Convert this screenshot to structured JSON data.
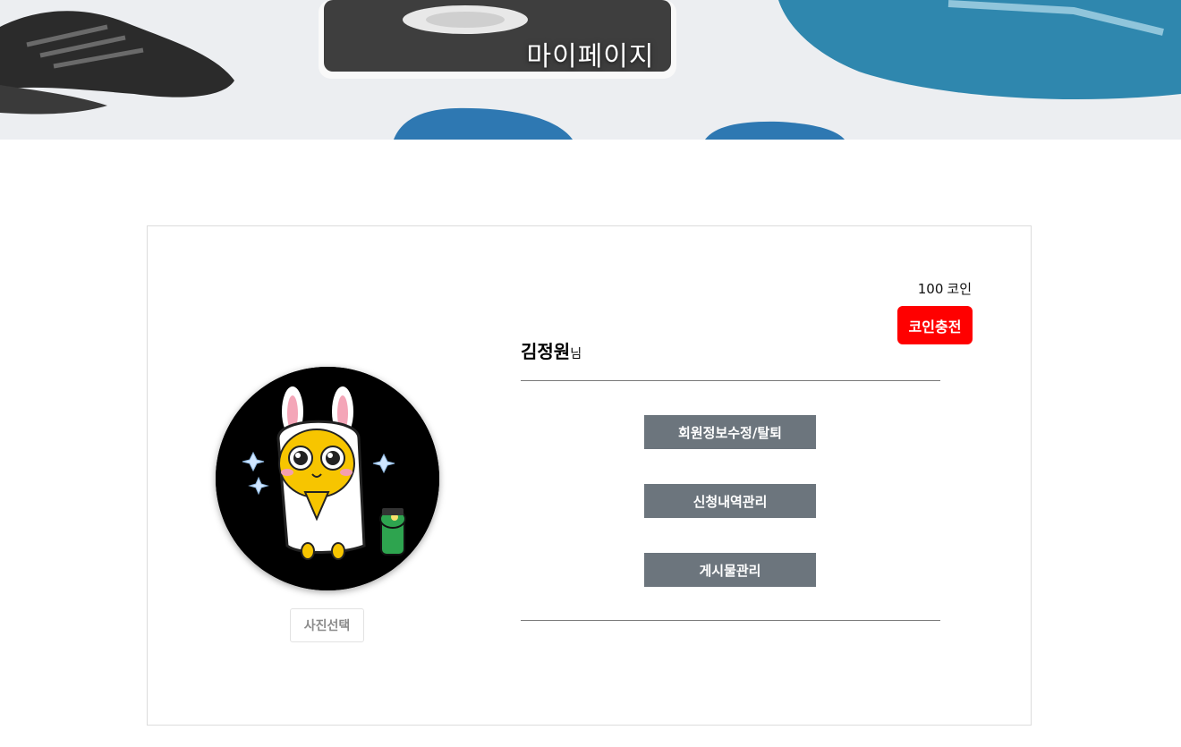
{
  "hero": {
    "title": "마이페이지"
  },
  "profile": {
    "user_name": "김정원",
    "honorific": "님",
    "photo_select_label": "사진선택",
    "avatar_icon": "kakao-character-avatar"
  },
  "coins": {
    "amount": "100",
    "unit": "코인",
    "charge_label": "코인충전"
  },
  "menu": {
    "items": [
      {
        "label": "회원정보수정/탈퇴"
      },
      {
        "label": "신청내역관리"
      },
      {
        "label": "게시물관리"
      }
    ]
  },
  "colors": {
    "charge_button": "#ff0000",
    "menu_button": "#6c757d",
    "avatar_background": "#000000"
  }
}
